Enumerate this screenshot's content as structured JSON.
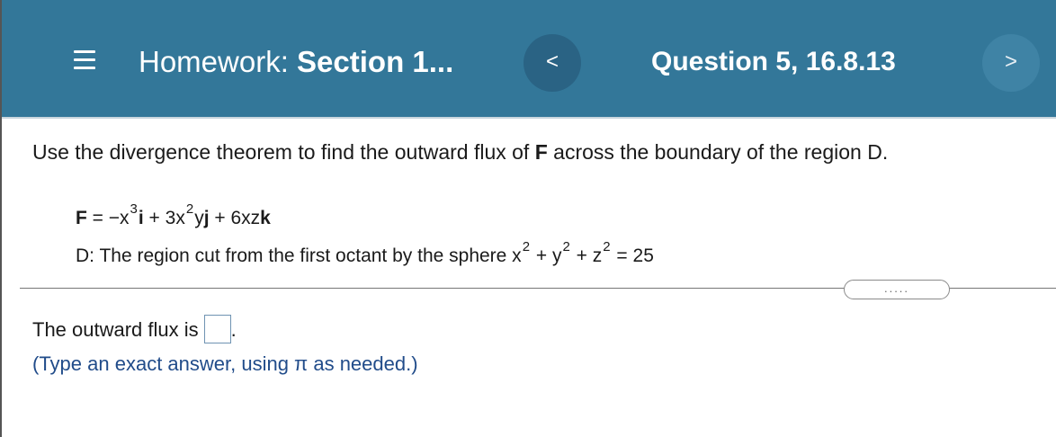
{
  "header": {
    "menu_icon": "hamburger-menu-icon",
    "homework_prefix": "Homework:",
    "homework_section": "Section 1...",
    "prev_glyph": "<",
    "question_title": "Question 5, 16.8.13",
    "next_glyph": ">",
    "bg_color": "#337799"
  },
  "question": {
    "prompt_before": "Use the divergence theorem to find the outward flux of ",
    "prompt_F": "F",
    "prompt_after": " across the boundary of the region D.",
    "field": {
      "lhs": "F",
      "eq": " = −x",
      "exp1": "3",
      "unit_i": "i",
      "mid1": " + 3x",
      "exp2": "2",
      "mid2": "y",
      "unit_j": "j",
      "mid3": " + 6xz",
      "unit_k": "k"
    },
    "region": {
      "prefix": "D: The region cut from the first octant by the sphere x",
      "exp_x": "2",
      "plus_y": " + y",
      "exp_y": "2",
      "plus_z": " + z",
      "exp_z": "2",
      "tail": " = 25"
    },
    "more_button_label": "....."
  },
  "answer": {
    "label": "The outward flux is",
    "value": "",
    "suffix": ".",
    "hint": "(Type an exact answer, using π as needed.)"
  }
}
